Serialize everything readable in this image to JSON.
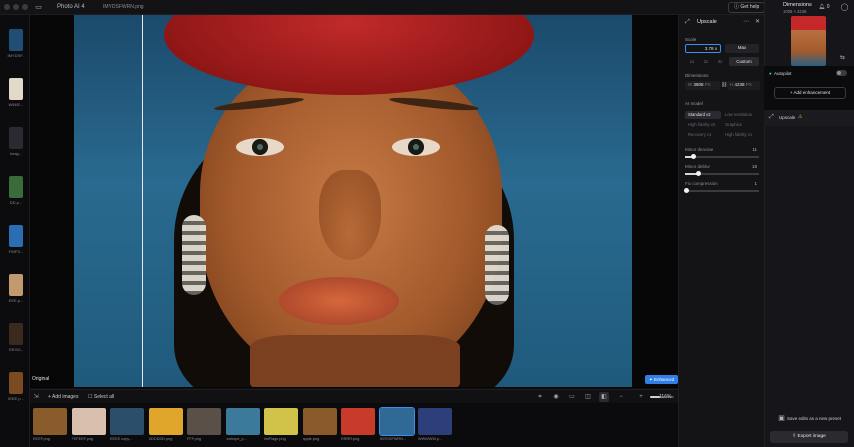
{
  "titlebar": {
    "app_title": "Photo AI",
    "app_version": "4",
    "file_name": "IMYDSFWRN.png",
    "get_help": "Get help"
  },
  "left_strip": [
    {
      "label": "IMYDSF..",
      "color": "#1f4e77"
    },
    {
      "label": "WINIE...",
      "color": "#e3d9c8"
    },
    {
      "label": "Imag...",
      "color": "#2a2a30"
    },
    {
      "label": "DD.p...",
      "color": "#3b6b3b"
    },
    {
      "label": "FWFS...",
      "color": "#2a6db3"
    },
    {
      "label": "EEE.p...",
      "color": "#c39a6f"
    },
    {
      "label": "EEGG..",
      "color": "#3a2a1d"
    },
    {
      "label": "IEEE.p...",
      "color": "#7a4a20"
    }
  ],
  "canvas": {
    "original_label": "Original",
    "enhanced_label": "Enhanced"
  },
  "bottom_bar": {
    "add_images": "Add images",
    "select_all": "Select all",
    "zoom": "116%",
    "zoom_fraction": 0.4
  },
  "filmstrip": [
    {
      "label": "EEEF.png",
      "color": "#8a5c2c",
      "selected": false
    },
    {
      "label": "FEFEEF.png",
      "color": "#d8bfae",
      "selected": false
    },
    {
      "label": "EEEE copy...",
      "color": "#2b4e6a",
      "selected": false
    },
    {
      "label": "DDDDDD.png",
      "color": "#e0a52b",
      "selected": false
    },
    {
      "label": "FFF.png",
      "color": "#5a5048",
      "selected": false
    },
    {
      "label": "ronhope_p...",
      "color": "#3b7a9a",
      "selected": false
    },
    {
      "label": "ImfRage.png",
      "color": "#d1c24a",
      "selected": false
    },
    {
      "label": "apple.png",
      "color": "#8a5a2a",
      "selected": false
    },
    {
      "label": "RRRR.png",
      "color": "#c83a2a",
      "selected": false
    },
    {
      "label": "IMYDSFWRN...",
      "color": "#2f6a95",
      "selected": true
    },
    {
      "label": "WWWWW.p...",
      "color": "#2d3f7a",
      "selected": false
    }
  ],
  "upscale_panel": {
    "title": "Upscale",
    "scale_label": "Scale",
    "scale_value": "3.78",
    "scale_unit": "x",
    "max": "Max",
    "presets": [
      "1x",
      "2x",
      "4x",
      "Custom"
    ],
    "dimensions_label": "Dimensions",
    "width_prefix": "W",
    "width_value": "3808",
    "width_unit": "PX",
    "height_prefix": "H",
    "height_value": "4238",
    "height_unit": "PX",
    "ai_model_label": "AI model",
    "models": [
      {
        "label": "Standard v2",
        "active": true
      },
      {
        "label": "Low resolution",
        "active": false
      },
      {
        "label": "High fidelity v2",
        "active": false
      },
      {
        "label": "Graphics",
        "active": false
      },
      {
        "label": "Recovery v1",
        "active": false
      },
      {
        "label": "High fidelity v1",
        "active": false
      }
    ],
    "sliders": [
      {
        "label": "Minor denoise",
        "value": "11",
        "fraction": 0.11
      },
      {
        "label": "Minor deblur",
        "value": "18",
        "fraction": 0.18
      },
      {
        "label": "Fix compression",
        "value": "1",
        "fraction": 0.01
      }
    ]
  },
  "far_panel": {
    "title": "Dimensions",
    "dims": "1008 × 4238",
    "count": "0",
    "autopilot": "Autopilot",
    "add_enhancement": "Add enhancement",
    "upscale_item": "Upscale",
    "save_edits": "Save edits as a new preset",
    "export": "Export image"
  }
}
